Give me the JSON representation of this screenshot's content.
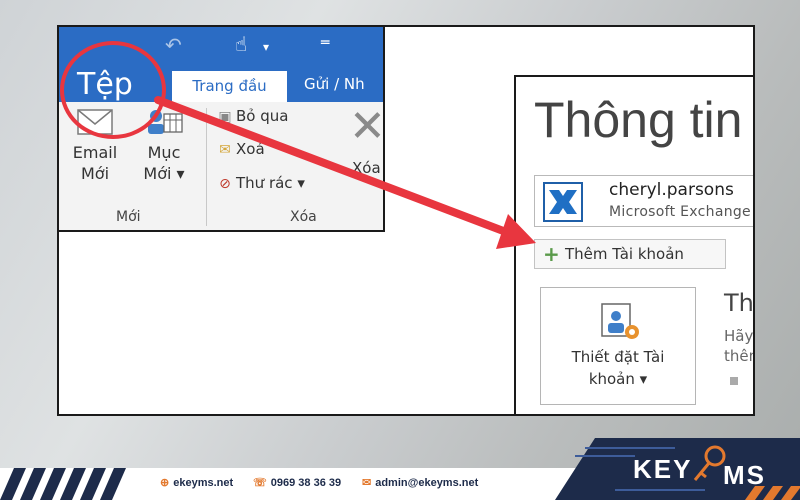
{
  "ribbon": {
    "tab_file": "Tệp",
    "tab_home": "Trang đầu",
    "tab_send": "Gửi / Nh",
    "new_email": [
      "Email",
      "Mới"
    ],
    "new_items": [
      "Mục",
      "Mới ▾"
    ],
    "group_new": "Mới",
    "ignore": "Bỏ qua",
    "cleanup": "Xoá",
    "junk": "Thư rác ▾",
    "delete": "Xóa",
    "group_delete": "Xóa"
  },
  "backstage": {
    "title": "Thông tin",
    "account_name": "cheryl.parsons",
    "account_type": "Microsoft Exchange",
    "add_account": "Thêm Tài khoản",
    "account_settings": [
      "Thiết đặt Tài",
      "khoản ▾"
    ],
    "settings_heading": "Th",
    "settings_line1": "Hãy",
    "settings_line2": "thêm"
  },
  "footer": {
    "website": "ekeyms.net",
    "phone": "0969 38 36 39",
    "email": "admin@ekeyms.net"
  },
  "colors": {
    "office_blue": "#2b6cc4",
    "highlight_red": "#e8363f",
    "brand_orange": "#e3792e",
    "brand_navy": "#1d2b4a"
  }
}
